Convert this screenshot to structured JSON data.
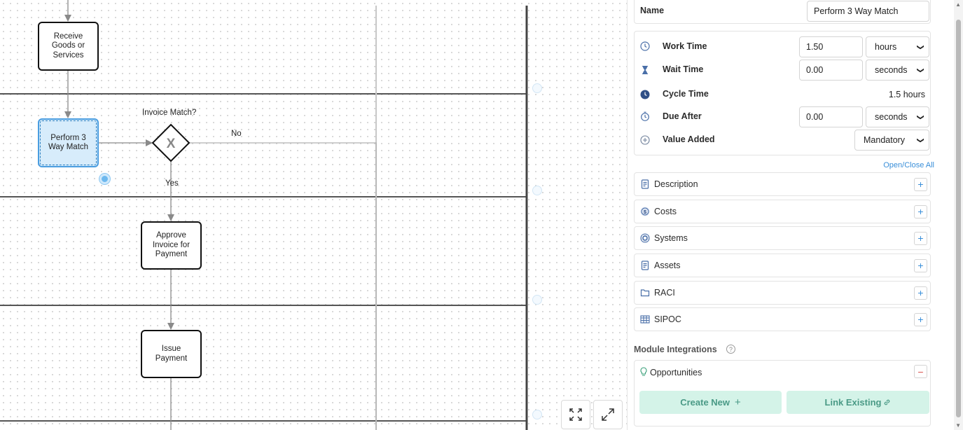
{
  "canvas": {
    "tasks": {
      "receive": "Receive Goods or Services",
      "perform": "Perform 3 Way Match",
      "approve": "Approve Invoice for Payment",
      "issue": "Issue Payment"
    },
    "gateway_label": "Invoice Match?",
    "gateway_symbol": "X",
    "yes_label": "Yes",
    "no_label": "No"
  },
  "panel": {
    "name": {
      "label": "Name",
      "value": "Perform 3 Way Match"
    },
    "work_time": {
      "label": "Work Time",
      "value": "1.50",
      "unit": "hours",
      "icon": "clock-icon"
    },
    "wait_time": {
      "label": "Wait Time",
      "value": "0.00",
      "unit": "seconds",
      "icon": "hourglass-icon"
    },
    "cycle_time": {
      "label": "Cycle Time",
      "value": "1.5 hours",
      "icon": "clock-filled-icon"
    },
    "due_after": {
      "label": "Due After",
      "value": "0.00",
      "unit": "seconds",
      "icon": "timer-icon"
    },
    "value_added": {
      "label": "Value Added",
      "value": "Mandatory",
      "icon": "plus-circle-icon"
    },
    "open_close_all": "Open/Close All",
    "sections": [
      {
        "title": "Description",
        "icon": "document-icon",
        "toggle": "+"
      },
      {
        "title": "Costs",
        "icon": "dollar-icon",
        "toggle": "+"
      },
      {
        "title": "Systems",
        "icon": "chip-icon",
        "toggle": "+"
      },
      {
        "title": "Assets",
        "icon": "document-icon",
        "toggle": "+"
      },
      {
        "title": "RACI",
        "icon": "folder-icon",
        "toggle": "+"
      },
      {
        "title": "SIPOC",
        "icon": "table-icon",
        "toggle": "+"
      }
    ],
    "module_integrations": {
      "label": "Module Integrations",
      "help": "?"
    },
    "opportunities": {
      "title": "Opportunities",
      "toggle": "−",
      "create_new": "Create New",
      "create_icon": "+",
      "link_existing": "Link Existing"
    }
  },
  "colors": {
    "accent": "#3a8fd9",
    "green_bg": "#d4f3e8",
    "green_text": "#4a9a86",
    "selected_bg": "#d7ecfb",
    "remove": "#d9534f"
  }
}
